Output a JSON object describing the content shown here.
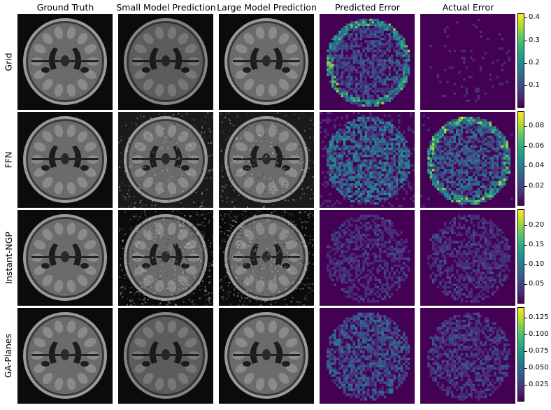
{
  "column_titles": [
    "Ground Truth",
    "Small Model Prediction",
    "Large Model Prediction",
    "Predicted Error",
    "Actual Error"
  ],
  "rows": [
    {
      "label": "Grid",
      "colorbar_ticks": [
        "0.4",
        "0.3",
        "0.2",
        "0.1"
      ],
      "colorbar_tick_values": [
        0.4,
        0.3,
        0.2,
        0.1
      ],
      "colorbar_range": [
        0,
        0.42
      ]
    },
    {
      "label": "FFN",
      "colorbar_ticks": [
        "0.08",
        "0.06",
        "0.04",
        "0.02"
      ],
      "colorbar_tick_values": [
        0.08,
        0.06,
        0.04,
        0.02
      ],
      "colorbar_range": [
        0,
        0.095
      ]
    },
    {
      "label": "Instant-NGP",
      "colorbar_ticks": [
        "0.20",
        "0.15",
        "0.10",
        "0.05"
      ],
      "colorbar_tick_values": [
        0.2,
        0.15,
        0.1,
        0.05
      ],
      "colorbar_range": [
        0,
        0.24
      ]
    },
    {
      "label": "GA-Planes",
      "colorbar_ticks": [
        "0.125",
        "0.100",
        "0.075",
        "0.050",
        "0.025"
      ],
      "colorbar_tick_values": [
        0.125,
        0.1,
        0.075,
        0.05,
        0.025
      ],
      "colorbar_range": [
        0,
        0.14
      ]
    }
  ],
  "colormap": [
    "#440154",
    "#472d7b",
    "#3b528b",
    "#2c728e",
    "#21918c",
    "#28ae80",
    "#5ec962",
    "#addc30",
    "#fde725"
  ]
}
